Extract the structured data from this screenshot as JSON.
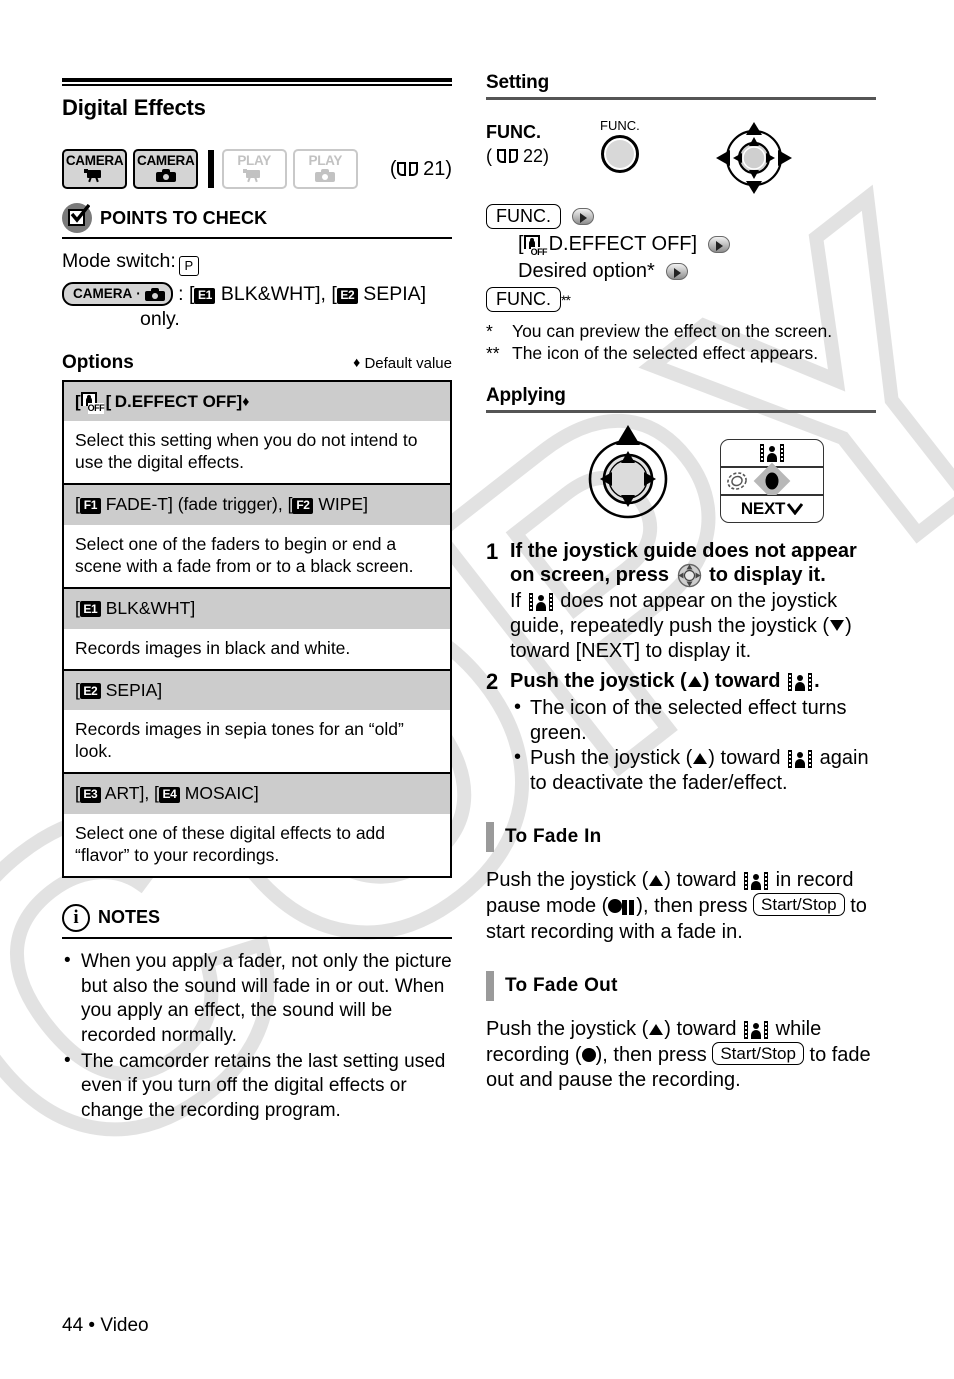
{
  "page": {
    "number": "44",
    "footer_separator": "•",
    "footer_section": "Video"
  },
  "left": {
    "section_title": "Digital Effects",
    "mode_badges": [
      {
        "name": "camera-video",
        "line1": "CAMERA",
        "icon": "camcorder-icon",
        "active": true
      },
      {
        "name": "camera-photo",
        "line1": "CAMERA",
        "icon": "photo-camera-icon",
        "active": true
      },
      {
        "name": "play-video",
        "line1": "PLAY",
        "icon": "camcorder-icon",
        "active": false
      },
      {
        "name": "play-photo",
        "line1": "PLAY",
        "icon": "photo-camera-icon",
        "active": false
      }
    ],
    "page_reference": "21",
    "points_to_check": {
      "title": "POINTS TO CHECK",
      "mode_switch_label": "Mode switch:",
      "mode_switch_value": "P",
      "camera_pill_label": "CAMERA",
      "restriction_prefix": ":",
      "restriction_items": [
        {
          "chip": "E1",
          "label": "BLK&WHT"
        },
        {
          "chip": "E2",
          "label": "SEPIA"
        }
      ],
      "restriction_suffix": "only."
    },
    "options": {
      "label": "Options",
      "default_marker": "♦",
      "default_text": "Default value",
      "rows": [
        {
          "header_icon": "d-effect-off-icon",
          "header": "[ D.EFFECT OFF]",
          "header_default_marker": "♦",
          "bold": true,
          "description": "Select this setting when you do not intend to use the digital effects."
        },
        {
          "header_chips": [
            {
              "chip": "F1",
              "label": "FADE-T] (fade trigger), ["
            },
            {
              "chip": "F2",
              "label": "WIPE]"
            }
          ],
          "header_open": "[",
          "description": "Select one of the faders to begin or end a scene with a fade from or to a black screen."
        },
        {
          "header_chips": [
            {
              "chip": "E1",
              "label": "BLK&WHT]"
            }
          ],
          "header_open": "[",
          "description": "Records images in black and white."
        },
        {
          "header_chips": [
            {
              "chip": "E2",
              "label": "SEPIA]"
            }
          ],
          "header_open": "[",
          "description": "Records images in sepia tones for an “old” look."
        },
        {
          "header_chips": [
            {
              "chip": "E3",
              "label": "ART], ["
            },
            {
              "chip": "E4",
              "label": "MOSAIC]"
            }
          ],
          "header_open": "[",
          "description": "Select one of these digital effects to add “flavor” to your recordings."
        }
      ]
    },
    "notes": {
      "title": "NOTES",
      "icon": "info-icon",
      "items": [
        "When you apply a fader, not only the picture but also the sound will fade in or out. When you apply an effect, the sound will be recorded normally.",
        "The camcorder retains the last setting used even if you turn off the digital effects or change the recording program."
      ]
    }
  },
  "right": {
    "setting": {
      "title": "Setting",
      "func_label": "FUNC.",
      "func_page_open": "(",
      "func_page": "22)",
      "func_button_caption": "FUNC.",
      "sequence": [
        {
          "type": "box",
          "text": "FUNC.",
          "arrow": true
        },
        {
          "type": "indented",
          "icon": "d-effect-off-icon",
          "text": "D.EFFECT OFF]",
          "open": "[",
          "arrow": true
        },
        {
          "type": "indented",
          "text": "Desired option*",
          "arrow": true
        },
        {
          "type": "box",
          "text": "FUNC.",
          "superscript": "**"
        }
      ],
      "footnotes": [
        {
          "marker": "*",
          "text": "You can preview the effect on the screen."
        },
        {
          "marker": "**",
          "text": "The icon of the selected effect appears."
        }
      ]
    },
    "applying": {
      "title": "Applying",
      "guide_box": {
        "top_icon": "digital-effects-film-icon",
        "mid_left_icon": "shutter-icon",
        "mid_right_icon": "record-diamond-icon",
        "bottom_label": "NEXT",
        "bottom_icon": "chevron-down-icon"
      },
      "steps": [
        {
          "number": "1",
          "lead_part1": "If the joystick guide does not appear on screen, press",
          "lead_icon": "joystick-icon",
          "lead_part2": "to display it.",
          "sub_part1": "If",
          "sub_icon": "digital-effects-film-icon",
          "sub_part2": "does not appear on the joystick guide, repeatedly push the joystick (",
          "sub_arrow": "▼",
          "sub_part3": ") toward [NEXT] to display it."
        },
        {
          "number": "2",
          "lead_part1": "Push the joystick (",
          "lead_arrow": "▲",
          "lead_part2": ") toward",
          "lead_icon": "digital-effects-film-icon",
          "lead_part3": ".",
          "bullets": [
            {
              "text": "The icon of the selected effect turns green."
            },
            {
              "part1": "Push the joystick (",
              "arrow": "▲",
              "part2": ") toward",
              "icon": "digital-effects-film-icon",
              "part3": "again to deactivate the fader/effect."
            }
          ]
        }
      ],
      "fade_in": {
        "title_small_caps": "T",
        "title": "o Fade In",
        "title_full": "To Fade In",
        "part1": "Push the joystick (",
        "arrow": "▲",
        "part2": ") toward",
        "icon": "digital-effects-film-icon",
        "part3": "in record pause mode (",
        "mode_icon": "record-pause-icon",
        "part4": "), then press",
        "button": "Start/Stop",
        "part5": "to start recording with a fade in."
      },
      "fade_out": {
        "title_full": "To Fade Out",
        "part1": "Push the joystick (",
        "arrow": "▲",
        "part2": ") toward",
        "icon": "digital-effects-film-icon",
        "part3": "while recording (",
        "mode_icon": "record-icon",
        "part4": "), then press",
        "button": "Start/Stop",
        "part5": "to fade out and pause the recording."
      }
    }
  },
  "watermark": {
    "text": "COPY"
  }
}
